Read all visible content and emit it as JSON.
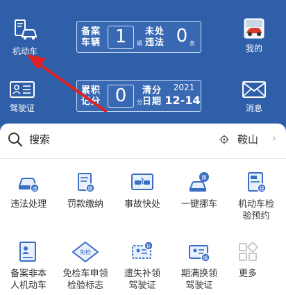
{
  "header": {
    "vehicle_label": "机动车",
    "my_label": "我的",
    "license_label": "驾驶证",
    "message_label": "消息"
  },
  "vehicle_panel": {
    "registered_label_1": "备案",
    "registered_label_2": "车辆",
    "registered_count": "1",
    "registered_unit": "辆",
    "violation_label_1": "未处",
    "violation_label_2": "违法",
    "violation_count": "0",
    "violation_unit": "条"
  },
  "license_panel": {
    "points_label_1": "累积",
    "points_label_2": "记分",
    "points_value": "0",
    "points_unit": "分",
    "clear_label_1": "清分",
    "clear_label_2": "日期",
    "clear_year": "2021",
    "clear_date": "12-14"
  },
  "search": {
    "label": "搜索",
    "location": "鞍山",
    "chevron": "›"
  },
  "services": [
    {
      "label": "违法处理",
      "icon": "violation-handle-icon"
    },
    {
      "label": "罚款缴纳",
      "icon": "fine-payment-icon"
    },
    {
      "label": "事故快处",
      "icon": "accident-quick-icon"
    },
    {
      "label": "一键挪车",
      "icon": "move-car-icon"
    },
    {
      "label": "机动车检\n验预约",
      "icon": "inspection-booking-icon"
    },
    {
      "label": "备案非本\n人机动车",
      "icon": "register-vehicle-icon"
    },
    {
      "label": "免检车申领\n检验标志",
      "icon": "exempt-sticker-icon"
    },
    {
      "label": "遗失补领\n驾驶证",
      "icon": "reissue-license-icon"
    },
    {
      "label": "期满换领\n驾驶证",
      "icon": "renew-license-icon"
    },
    {
      "label": "更多",
      "icon": "more-icon"
    }
  ],
  "colors": {
    "header_blue": "#2f5fa9",
    "icon_blue": "#3a6fc4",
    "arrow_red": "#e02020"
  }
}
